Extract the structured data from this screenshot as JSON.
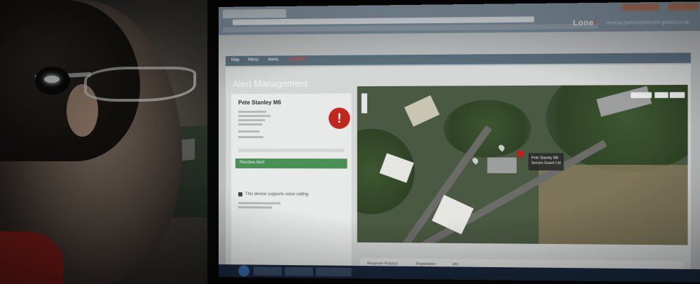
{
  "browser": {
    "tab_title": "",
    "brand": {
      "name": "Lone",
      "accent": "r"
    },
    "user_email": "dewna.parkes@secure-guard.co.uk"
  },
  "nav": {
    "items": [
      "Map",
      "Menu",
      "Alerts"
    ],
    "alert_label": "ALERTS"
  },
  "page": {
    "title": "Alert Management"
  },
  "alert": {
    "person_name": "Pete Stanley M6",
    "icon": "exclamation-icon",
    "resolve_label": "Resolve Alert",
    "call_text": "This device supports voice calling"
  },
  "map": {
    "marker_label_line1": "Pete Stanley M6",
    "marker_label_line2": "Secure-Guard Ltd"
  },
  "bottom_tabs": [
    "Response Protocol",
    "Registration",
    "Info"
  ],
  "colors": {
    "alert_red": "#c2271f",
    "resolve_green": "#4a8f55",
    "navbar": "#5a6e7c"
  }
}
